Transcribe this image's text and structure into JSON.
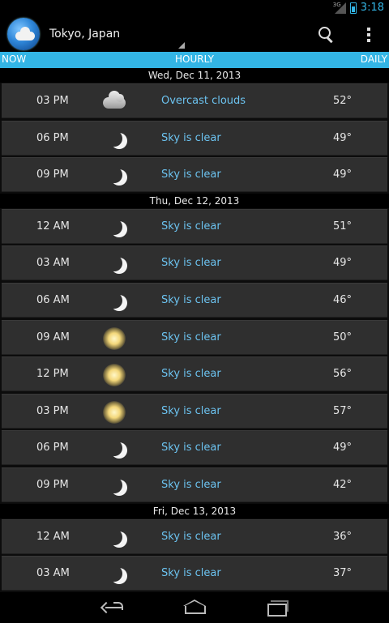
{
  "status_bar": {
    "network": "3G",
    "time": "3:18"
  },
  "action_bar": {
    "location": "Tokyo, Japan",
    "app_icon": "weather-globe-cloud-icon",
    "search_icon": "search-icon",
    "overflow_icon": "overflow-menu-icon"
  },
  "tabs": {
    "now": "NOW",
    "hourly": "HOURLY",
    "daily": "DAILY",
    "selected": "HOURLY"
  },
  "colors": {
    "accent": "#33b5e5",
    "row_bg": "#2f2f2f",
    "desc": "#6cc3f0"
  },
  "days": [
    {
      "date": "Wed, Dec 11, 2013",
      "hours": [
        {
          "time": "03 PM",
          "icon": "cloud",
          "desc": "Overcast clouds",
          "temp": "52°"
        },
        {
          "time": "06 PM",
          "icon": "moon",
          "desc": "Sky is clear",
          "temp": "49°"
        },
        {
          "time": "09 PM",
          "icon": "moon",
          "desc": "Sky is clear",
          "temp": "49°"
        }
      ]
    },
    {
      "date": "Thu, Dec 12, 2013",
      "hours": [
        {
          "time": "12 AM",
          "icon": "moon",
          "desc": "Sky is clear",
          "temp": "51°"
        },
        {
          "time": "03 AM",
          "icon": "moon",
          "desc": "Sky is clear",
          "temp": "49°"
        },
        {
          "time": "06 AM",
          "icon": "moon",
          "desc": "Sky is clear",
          "temp": "46°"
        },
        {
          "time": "09 AM",
          "icon": "sun",
          "desc": "Sky is clear",
          "temp": "50°"
        },
        {
          "time": "12 PM",
          "icon": "sun",
          "desc": "Sky is clear",
          "temp": "56°"
        },
        {
          "time": "03 PM",
          "icon": "sun",
          "desc": "Sky is clear",
          "temp": "57°"
        },
        {
          "time": "06 PM",
          "icon": "moon",
          "desc": "Sky is clear",
          "temp": "49°"
        },
        {
          "time": "09 PM",
          "icon": "moon",
          "desc": "Sky is clear",
          "temp": "42°"
        }
      ]
    },
    {
      "date": "Fri, Dec 13, 2013",
      "hours": [
        {
          "time": "12 AM",
          "icon": "moon",
          "desc": "Sky is clear",
          "temp": "36°"
        },
        {
          "time": "03 AM",
          "icon": "moon",
          "desc": "Sky is clear",
          "temp": "37°"
        }
      ]
    }
  ],
  "nav_bar": {
    "back_icon": "back-icon",
    "home_icon": "home-icon",
    "recents_icon": "recent-apps-icon"
  }
}
